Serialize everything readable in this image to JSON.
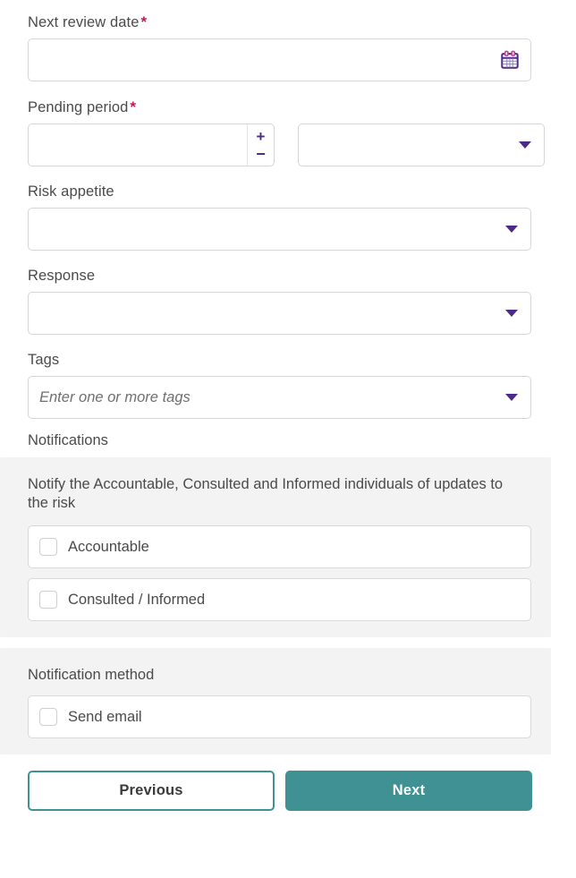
{
  "theme": {
    "accent_teal": "#3f9193",
    "accent_purple": "#4b2a8a",
    "required_star": "#c2185b",
    "panel_bg": "#f4f3f3",
    "label_text": "#4a4a4a",
    "input_border": "#d6d6d6"
  },
  "fields": {
    "next_review_date": {
      "label": "Next review date",
      "required_marker": "*",
      "value": "",
      "placeholder": "",
      "icon": "calendar-icon"
    },
    "pending_period": {
      "label": "Pending period",
      "required_marker": "*",
      "amount_value": "",
      "amount_placeholder": "",
      "increment_label": "+",
      "decrement_label": "−",
      "unit_value": "",
      "unit_placeholder": ""
    },
    "risk_appetite": {
      "label": "Risk appetite",
      "value": "",
      "placeholder": ""
    },
    "response": {
      "label": "Response",
      "value": "",
      "placeholder": ""
    },
    "tags": {
      "label": "Tags",
      "value": "",
      "placeholder": "Enter one or more tags"
    }
  },
  "notifications": {
    "heading": "Notifications",
    "panel_title": "Notify the Accountable, Consulted and Informed individuals of updates to the risk",
    "options": [
      {
        "label": "Accountable",
        "checked": false
      },
      {
        "label": "Consulted / Informed",
        "checked": false
      }
    ]
  },
  "notification_method": {
    "panel_title": "Notification method",
    "options": [
      {
        "label": "Send email",
        "checked": false
      }
    ]
  },
  "footer": {
    "previous_label": "Previous",
    "next_label": "Next"
  }
}
